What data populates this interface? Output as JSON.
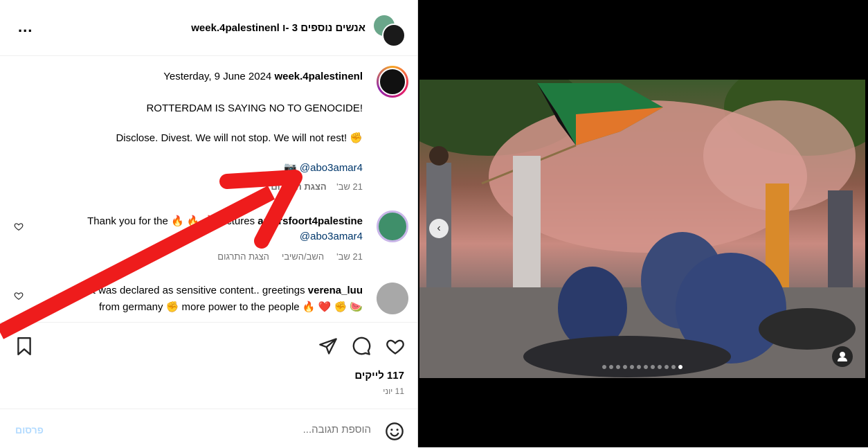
{
  "header": {
    "title": "אנשים נוספים 3 -ו week.4palestinenl",
    "more_label": "...",
    "more_icon": "more-horizontal-icon"
  },
  "post": {
    "date": "Yesterday, 9 June 2024",
    "author": "week.4palestinenl",
    "line1": "ROTTERDAM IS SAYING NO TO GENOCIDE!",
    "line2": "Disclose. Divest. We will not stop. We will not rest! ✊",
    "mention_prefix": "📷",
    "mention": "@abo3amar4",
    "meta_time": "21 שב'",
    "meta_action": "הצגת התרגום"
  },
  "comments": [
    {
      "user": "amersfoort4palestine",
      "text_start": "Thank you for the 🔥 🔥 🔥 pictures",
      "mention": "@abo3amar4",
      "time": "21 שב'",
      "reply": "השב/השיבי",
      "translate": "הצגת התרגום"
    },
    {
      "user": "verena_luu",
      "text_start": "Post was declared as sensitive content.. greetings",
      "text_end": "from germany ✊ more power to the people 🔥 ❤️ ✊ 🍉"
    }
  ],
  "actions": {
    "likes": "117 לייקים",
    "date": "11 יוני",
    "icons": [
      "heart-icon",
      "comment-icon",
      "share-icon",
      "bookmark-icon"
    ]
  },
  "comment_box": {
    "placeholder": "הוספת תגובה...",
    "post_label": "פרסום"
  },
  "carousel": {
    "prev_label": "‹",
    "dot_count": 12,
    "active_dot": 12
  },
  "colors": {
    "arrow": "#ee1c1c",
    "link": "#00376b",
    "post_button": "#b3dbff"
  }
}
